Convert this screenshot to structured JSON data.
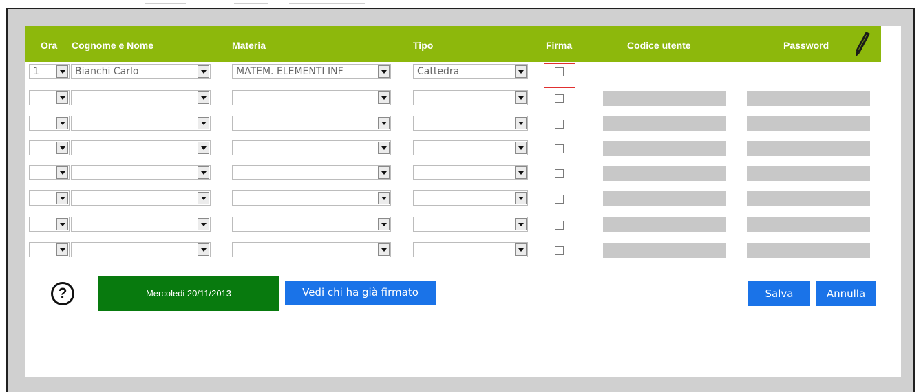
{
  "header": {
    "columns": {
      "ora": "Ora",
      "cognome_nome": "Cognome e Nome",
      "materia": "Materia",
      "tipo": "Tipo",
      "firma": "Firma",
      "codice_utente": "Codice utente",
      "password": "Password"
    },
    "edit_icon": "pencil-icon"
  },
  "rows": [
    {
      "ora": "1",
      "nome": "Bianchi Carlo",
      "materia": "MATEM. ELEMENTI INF",
      "tipo": "Cattedra",
      "firma": false,
      "active": true
    },
    {
      "ora": "",
      "nome": "",
      "materia": "",
      "tipo": "",
      "firma": false,
      "active": false
    },
    {
      "ora": "",
      "nome": "",
      "materia": "",
      "tipo": "",
      "firma": false,
      "active": false
    },
    {
      "ora": "",
      "nome": "",
      "materia": "",
      "tipo": "",
      "firma": false,
      "active": false
    },
    {
      "ora": "",
      "nome": "",
      "materia": "",
      "tipo": "",
      "firma": false,
      "active": false
    },
    {
      "ora": "",
      "nome": "",
      "materia": "",
      "tipo": "",
      "firma": false,
      "active": false
    },
    {
      "ora": "",
      "nome": "",
      "materia": "",
      "tipo": "",
      "firma": false,
      "active": false
    },
    {
      "ora": "",
      "nome": "",
      "materia": "",
      "tipo": "",
      "firma": false,
      "active": false
    }
  ],
  "footer": {
    "help_icon": "help-icon",
    "help_symbol": "?",
    "date_label": "Mercoledi 20/11/2013",
    "vedi_label": "Vedi chi ha già firmato",
    "salva_label": "Salva",
    "annulla_label": "Annulla"
  },
  "colors": {
    "header_green": "#8db80c",
    "date_green": "#087a0e",
    "button_blue": "#1a73e8",
    "readonly_gray": "#c8c8c8",
    "highlight_red": "#e03030"
  }
}
